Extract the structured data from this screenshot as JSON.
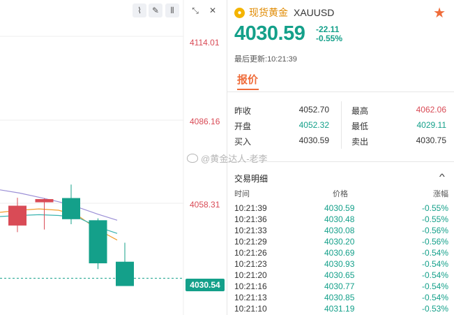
{
  "chart": {
    "toolbar": [
      {
        "name": "line-tool-icon",
        "glyph": "⌇"
      },
      {
        "name": "pen-tool-icon",
        "glyph": "✎"
      },
      {
        "name": "candle-type-icon",
        "glyph": "⫴"
      },
      {
        "name": "collapse-icon",
        "glyph": "⤡"
      },
      {
        "name": "close-icon",
        "glyph": "✕"
      }
    ],
    "price_ticks": [
      "4114.01",
      "4086.16",
      "4058.31"
    ],
    "current_price_tag": "4030.54",
    "ylim": [
      4028,
      4120
    ],
    "candles": [
      {
        "open": 4058.0,
        "close": 4050.5,
        "high": 4061.0,
        "low": 4048.0,
        "color": "#d94b56"
      },
      {
        "open": 4060.5,
        "close": 4059.3,
        "high": 4060.8,
        "low": 4049.0,
        "color": "#d94b56"
      },
      {
        "open": 4052.9,
        "close": 4060.9,
        "high": 4066.0,
        "low": 4051.0,
        "color": "#14a08a"
      },
      {
        "open": 4052.5,
        "close": 4036.2,
        "high": 4053.2,
        "low": 4034.0,
        "color": "#14a08a"
      },
      {
        "open": 4036.8,
        "close": 4027.6,
        "high": 4044.0,
        "low": 4027.6,
        "color": "#14a08a"
      }
    ],
    "ma_lines": [
      {
        "color": "#9b8fd6",
        "values": [
          4064.0,
          4062.8,
          4061.2,
          4059.5,
          4057.4,
          4054.8,
          4052.5
        ]
      },
      {
        "color": "#f39c2b",
        "values": [
          4055.5,
          4056.3,
          4056.8,
          4056.3,
          4054.2,
          4049.0,
          4045.0
        ]
      },
      {
        "color": "#3ab3b0",
        "values": [
          4053.9,
          4054.3,
          4054.6,
          4054.3,
          4053.5,
          4050.0,
          4047.5
        ]
      }
    ]
  },
  "quote": {
    "name": "现货黄金",
    "symbol": "XAUUSD",
    "price": "4030.59",
    "change": "-22.11",
    "change_pct": "-0.55%",
    "updated_label": "最后更新:",
    "updated_time": "10:21:39",
    "tab_label": "报价",
    "stats": {
      "prev_close_label": "昨收",
      "prev_close": "4052.70",
      "open_label": "开盘",
      "open": "4052.32",
      "bid_label": "买入",
      "bid": "4030.59",
      "high_label": "最高",
      "high": "4062.06",
      "low_label": "最低",
      "low": "4029.11",
      "ask_label": "卖出",
      "ask": "4030.75"
    },
    "colors": {
      "up": "#d94b56",
      "down": "#14a08a",
      "accent": "#ef6c3a"
    }
  },
  "watermark": "@黄金达人-老李",
  "trades": {
    "title": "交易明细",
    "headers": {
      "time": "时间",
      "price": "价格",
      "change": "涨幅"
    },
    "rows": [
      {
        "time": "10:21:39",
        "price": "4030.59",
        "change": "-0.55%"
      },
      {
        "time": "10:21:36",
        "price": "4030.48",
        "change": "-0.55%"
      },
      {
        "time": "10:21:33",
        "price": "4030.08",
        "change": "-0.56%"
      },
      {
        "time": "10:21:29",
        "price": "4030.20",
        "change": "-0.56%"
      },
      {
        "time": "10:21:26",
        "price": "4030.69",
        "change": "-0.54%"
      },
      {
        "time": "10:21:23",
        "price": "4030.93",
        "change": "-0.54%"
      },
      {
        "time": "10:21:20",
        "price": "4030.65",
        "change": "-0.54%"
      },
      {
        "time": "10:21:16",
        "price": "4030.77",
        "change": "-0.54%"
      },
      {
        "time": "10:21:13",
        "price": "4030.85",
        "change": "-0.54%"
      },
      {
        "time": "10:21:10",
        "price": "4031.19",
        "change": "-0.53%"
      }
    ]
  }
}
